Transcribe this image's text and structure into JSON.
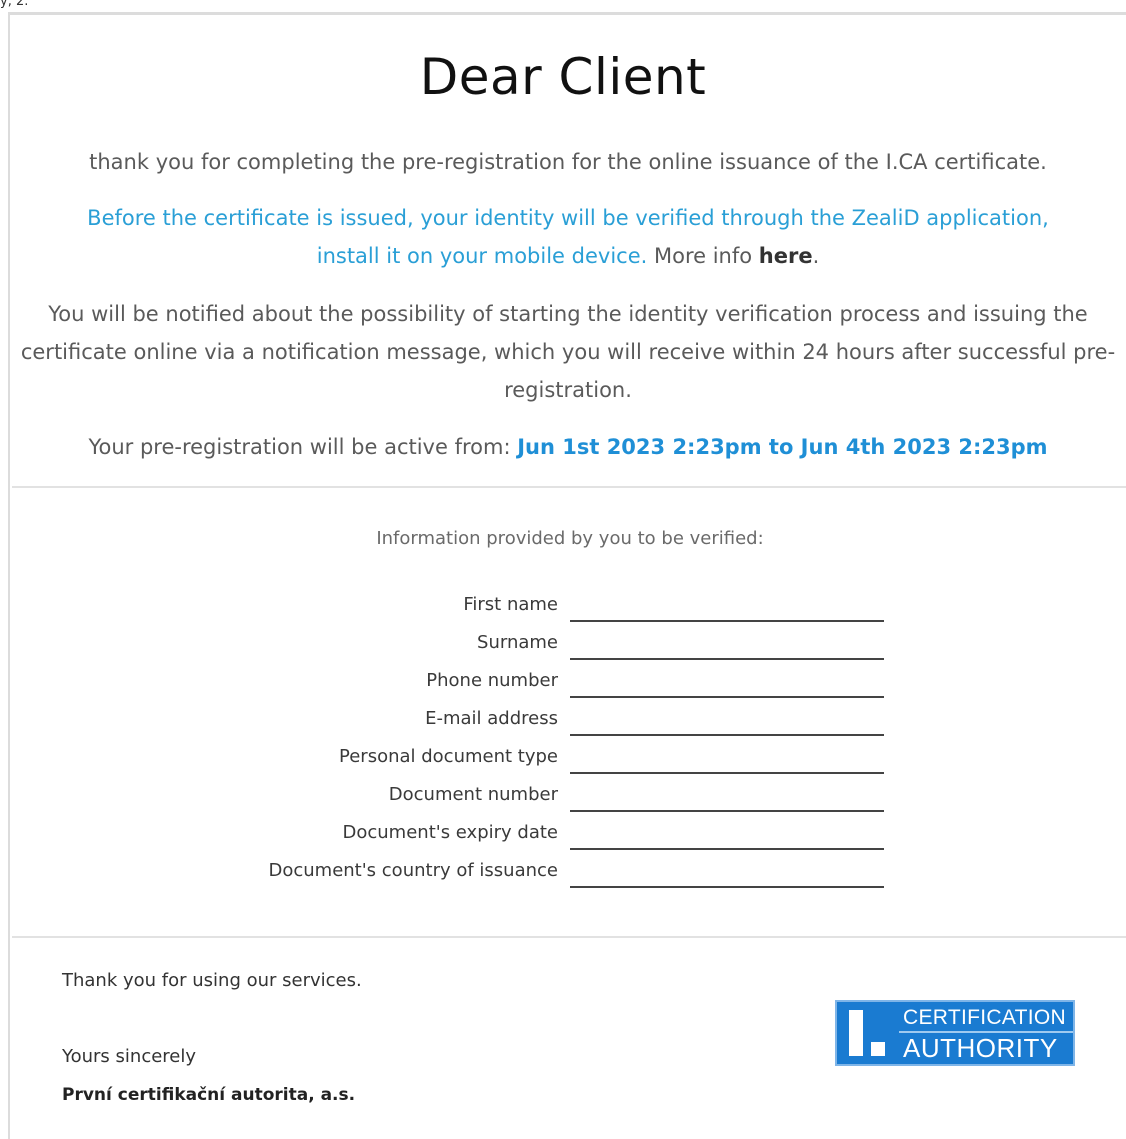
{
  "corner_label": "y, 2.",
  "title": "Dear Client",
  "intro": "thank you for completing the pre-registration for the online issuance of the I.CA certificate.",
  "verification": {
    "line1": "Before the certificate is issued, your identity will be verified through the ZealiD application,",
    "line2": "install it on your mobile device.",
    "more_info": " More info ",
    "here_link": "here",
    "period": "."
  },
  "notification": "You will be notified about the possibility of starting the identity verification process and issuing the certificate online via a notification message, which you will receive within 24 hours after successful pre-registration.",
  "active": {
    "label": "Your pre-registration will be active from: ",
    "range": "Jun 1st 2023 2:23pm to Jun 4th 2023 2:23pm"
  },
  "info_heading": "Information provided by you to be verified:",
  "fields": [
    {
      "label": "First name",
      "value": ""
    },
    {
      "label": "Surname",
      "value": ""
    },
    {
      "label": "Phone number",
      "value": ""
    },
    {
      "label": "E-mail address",
      "value": ""
    },
    {
      "label": "Personal document type",
      "value": ""
    },
    {
      "label": "Document number",
      "value": ""
    },
    {
      "label": "Document's expiry date",
      "value": ""
    },
    {
      "label": "Document's country of issuance",
      "value": ""
    }
  ],
  "closing": {
    "thanks": "Thank you for using our services.",
    "sincerely": "Yours sincerely",
    "company": "První certifikační autorita, a.s."
  },
  "logo": {
    "line1": "CERTIFICATION",
    "line2": "AUTHORITY",
    "brand_color": "#1a7bd1"
  },
  "colors": {
    "link_blue": "#2a9fd6",
    "date_blue": "#1f8fd6"
  }
}
